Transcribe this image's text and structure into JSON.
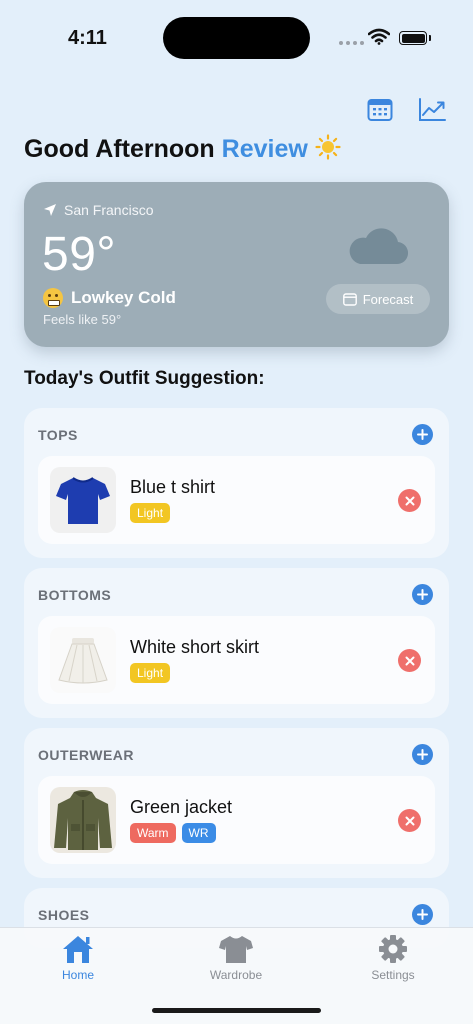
{
  "status_bar": {
    "time": "4:11"
  },
  "header": {
    "greeting": "Good Afternoon",
    "name": "Review",
    "emoji": "☀️",
    "calendar_icon": "calendar-icon",
    "trend_icon": "chart-trend-icon"
  },
  "weather": {
    "location": "San Francisco",
    "temperature": "59°",
    "condition": "Lowkey Cold",
    "feels_like": "Feels like 59°",
    "forecast_label": "Forecast",
    "cloud_icon": "cloud-icon"
  },
  "suggestions": {
    "title": "Today's Outfit Suggestion:",
    "categories": [
      {
        "label": "TOPS",
        "item": {
          "name": "Blue t shirt",
          "tags": [
            "Light"
          ]
        }
      },
      {
        "label": "BOTTOMS",
        "item": {
          "name": "White short skirt",
          "tags": [
            "Light"
          ]
        }
      },
      {
        "label": "OUTERWEAR",
        "item": {
          "name": "Green jacket",
          "tags": [
            "Warm",
            "WR"
          ]
        }
      },
      {
        "label": "SHOES"
      }
    ]
  },
  "tab_bar": {
    "tabs": [
      {
        "label": "Home",
        "icon": "house-icon",
        "active": true
      },
      {
        "label": "Wardrobe",
        "icon": "tshirt-icon",
        "active": false
      },
      {
        "label": "Settings",
        "icon": "gear-icon",
        "active": false
      }
    ]
  },
  "colors": {
    "background": "#e3effa",
    "accent": "#3b86de",
    "weather_card": "#9dadb7",
    "tag_light": "#f2c623",
    "tag_warm": "#ee6a60",
    "tag_wr": "#3b8ce6",
    "remove": "#ef6f6b"
  }
}
